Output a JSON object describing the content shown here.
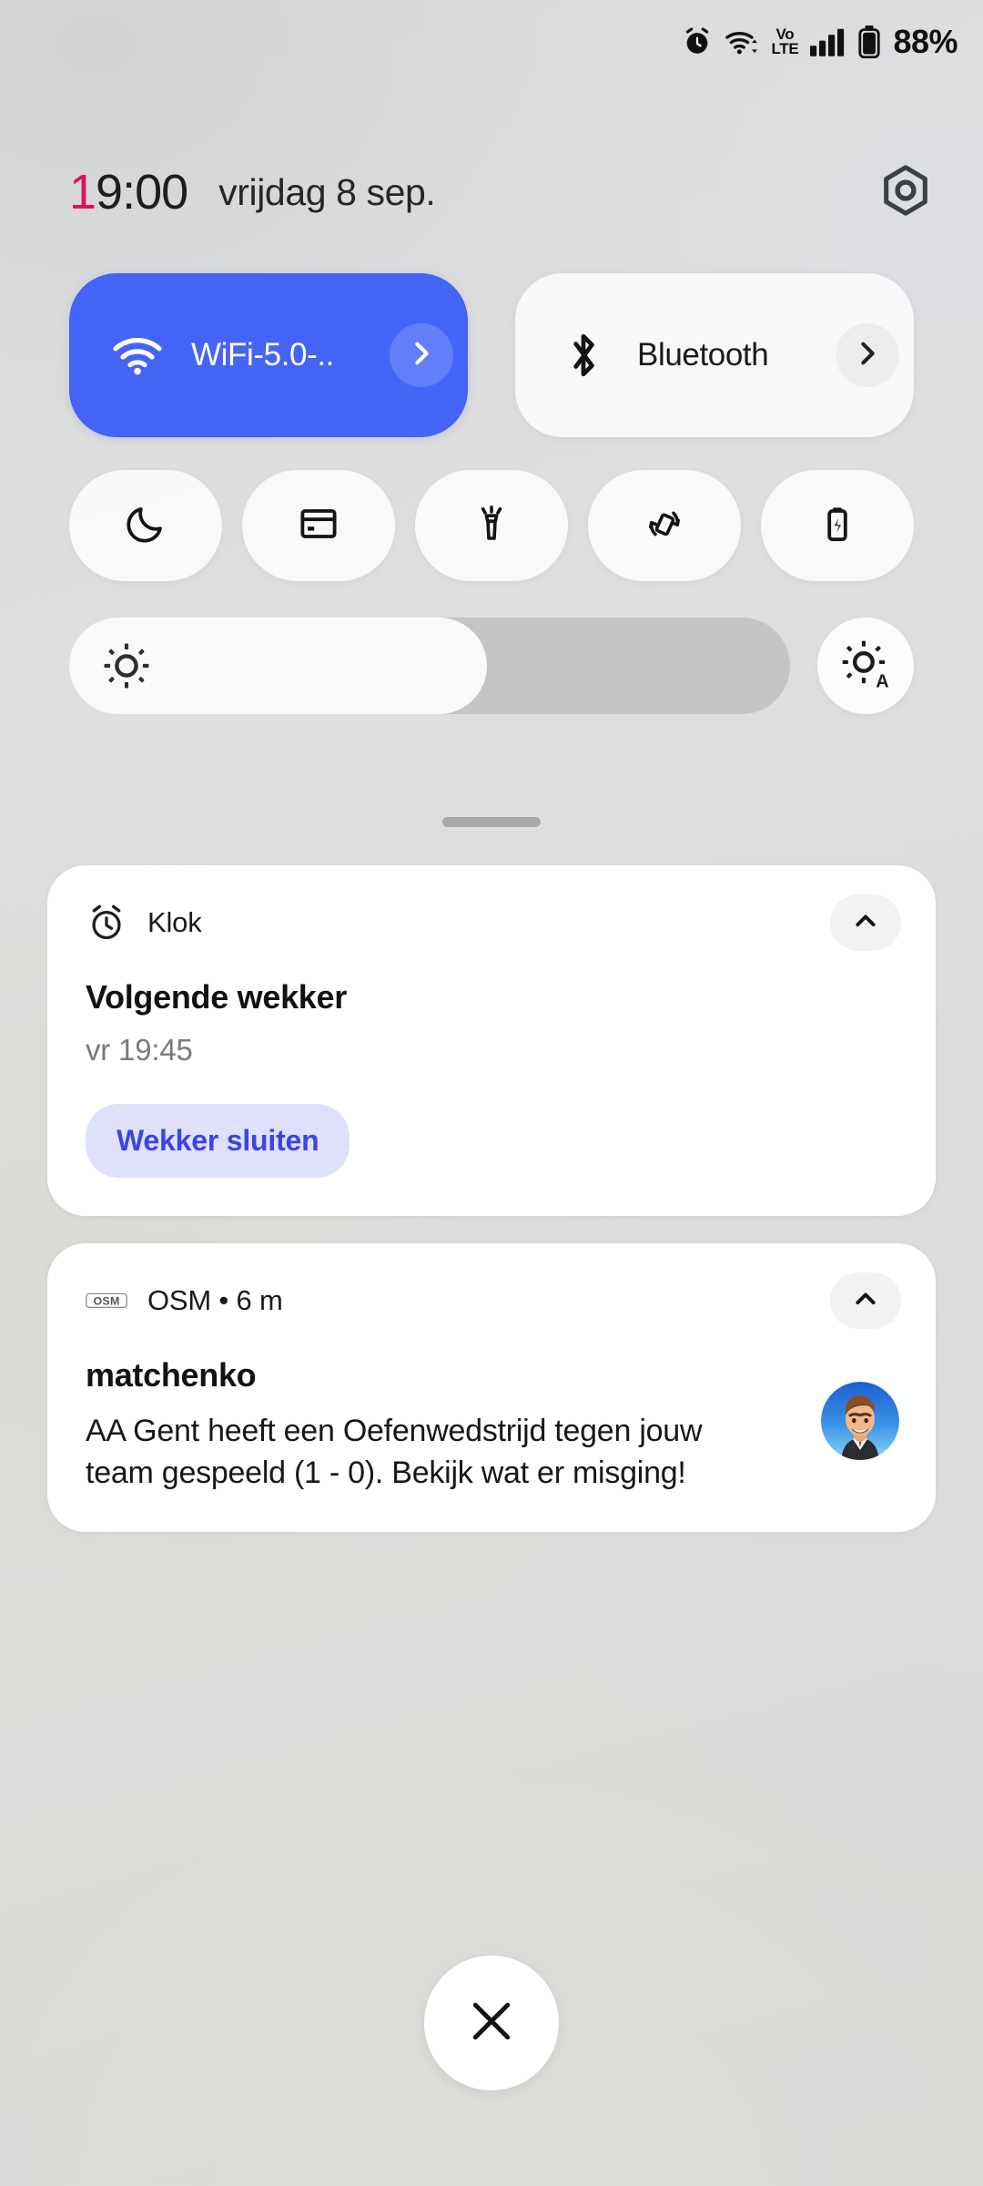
{
  "status_bar": {
    "battery_percent": "88%",
    "volte_top": "Vo",
    "volte_bottom": "LTE",
    "icons": [
      "alarm-icon",
      "wifi-icon",
      "volte-icon",
      "signal-icon",
      "battery-icon"
    ]
  },
  "header": {
    "time_accent": "1",
    "time_rest": "9:00",
    "date": "vrijdag 8 sep.",
    "settings_icon": "hexagon-settings-icon"
  },
  "quick_panel": {
    "big_tiles": [
      {
        "label": "WiFi-5.0-..",
        "icon": "wifi-icon",
        "state": "on",
        "chevron": "chevron-right-icon"
      },
      {
        "label": "Bluetooth",
        "icon": "bluetooth-icon",
        "state": "off",
        "chevron": "chevron-right-icon"
      }
    ],
    "toggles": [
      {
        "name": "do-not-disturb",
        "icon": "moon-icon"
      },
      {
        "name": "samsung-pay",
        "icon": "card-icon"
      },
      {
        "name": "flashlight",
        "icon": "flashlight-icon"
      },
      {
        "name": "auto-rotate",
        "icon": "rotate-icon"
      },
      {
        "name": "power-saving",
        "icon": "battery-bolt-icon"
      }
    ],
    "brightness": {
      "icon": "brightness-icon",
      "auto_icon": "brightness-auto-icon",
      "level_percent": 58
    },
    "colors": {
      "tile_active": "#4364f7",
      "tile_inactive": "#ffffff",
      "accent_pink": "#d6175c"
    }
  },
  "notifications": [
    {
      "app_icon": "alarm-clock-icon",
      "app_name": "Klok",
      "title": "Volgende wekker",
      "subtitle": "vr 19:45",
      "action_label": "Wekker sluiten",
      "collapse_icon": "chevron-up-icon",
      "has_avatar": false
    },
    {
      "app_icon": "osm-logo-icon",
      "app_name": "OSM • 6 m",
      "title": "matchenko",
      "body": "AA Gent heeft een Oefenwedstrijd tegen jouw team gespeeld (1 - 0). Bekijk wat er misging!",
      "collapse_icon": "chevron-up-icon",
      "has_avatar": true,
      "avatar": "user-avatar-icon"
    }
  ],
  "footer": {
    "close_label": "close-icon"
  }
}
